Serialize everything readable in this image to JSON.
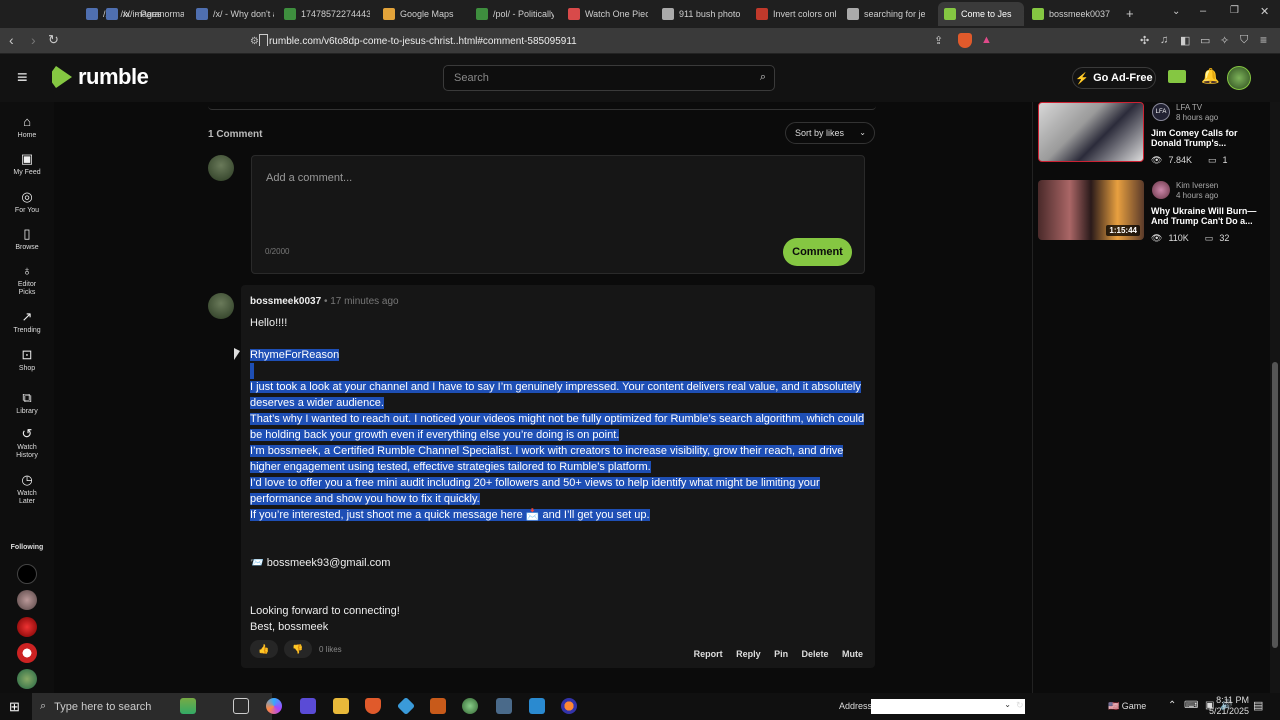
{
  "tabs": [
    {
      "label": "/x/ - /x/ images",
      "color": "#4f6fb0"
    },
    {
      "label": "/x/ - Paranormal",
      "color": "#4f6fb0"
    },
    {
      "label": "/x/ - Why don't a",
      "color": "#4f6fb0"
    },
    {
      "label": "17478572274443",
      "color": "#3e8e3e"
    },
    {
      "label": "Google Maps",
      "color": "#e2a33a"
    },
    {
      "label": "/pol/ - Politically",
      "color": "#3e8e3e"
    },
    {
      "label": "Watch One Piece",
      "color": "#d84a4a"
    },
    {
      "label": "911 bush photo",
      "color": "#aaaaaa"
    },
    {
      "label": "Invert colors onli",
      "color": "#c0392b"
    },
    {
      "label": "searching for jes",
      "color": "#aaaaaa"
    },
    {
      "label": "Come to Jes",
      "color": "#85c742",
      "active": true
    },
    {
      "label": "bossmeek0037",
      "color": "#85c742"
    }
  ],
  "urlbar": {
    "url": "rumble.com/v6to8dp-come-to-jesus-christ..html#comment-585095911"
  },
  "header": {
    "logo_text": "rumble",
    "search_placeholder": "Search",
    "go_ad_free_label": "Go Ad-Free"
  },
  "sidebar": {
    "items": [
      {
        "label": "Home",
        "icon": "home-icon",
        "glyph": "⌂"
      },
      {
        "label": "My Feed",
        "icon": "feed-icon",
        "glyph": "▣"
      },
      {
        "label": "For You",
        "icon": "target-icon",
        "glyph": "◎"
      },
      {
        "label": "Browse",
        "icon": "browse-icon",
        "glyph": "▯"
      },
      {
        "label": "Editor Picks",
        "icon": "award-icon",
        "glyph": "♁"
      },
      {
        "label": "Trending",
        "icon": "trending-icon",
        "glyph": "↗"
      },
      {
        "label": "Shop",
        "icon": "shop-icon",
        "glyph": "⊡"
      },
      {
        "label": "Library",
        "icon": "library-icon",
        "glyph": "⧉"
      },
      {
        "label": "Watch History",
        "icon": "history-icon",
        "glyph": "↺"
      },
      {
        "label": "Watch Later",
        "icon": "clock-icon",
        "glyph": "◷"
      }
    ],
    "following_label": "Following"
  },
  "comments": {
    "count_label": "1 Comment",
    "sort_label": "Sort by likes",
    "add_placeholder": "Add a comment...",
    "char_count": "0/2000",
    "submit_label": "Comment",
    "item": {
      "username": "bossmeek0037",
      "time": "17 minutes ago",
      "greeting": "Hello!!!!",
      "highlighted_lines": [
        "RhymeForReason",
        "I just took a look at your channel and I have to say I’m genuinely impressed. Your content delivers real value, and it absolutely deserves a wider audience.",
        "That’s why I wanted to reach out. I noticed your videos might not be fully optimized for Rumble’s search algorithm, which could be holding back your growth even if everything else you’re doing is on point.",
        "I’m bossmeek, a Certified Rumble Channel Specialist. I work with creators to increase visibility, grow their reach, and drive higher engagement using tested, effective strategies tailored to Rumble’s platform.",
        "I’d love to offer you a free mini audit including 20+ followers and 50+ views to help identify what might be limiting your performance and show you how to fix it quickly.",
        "If you’re interested, just shoot me a quick message here 📩 and I’ll get you set up."
      ],
      "email": "📨 bossmeek93@gmail.com",
      "closing1": "Looking forward to connecting!",
      "closing2": "Best, bossmeek",
      "likes": "0 likes",
      "actions": [
        "Report",
        "Reply",
        "Pin",
        "Delete",
        "Mute"
      ]
    }
  },
  "related": [
    {
      "channel": "LFA TV",
      "time": "8 hours ago",
      "title": "Jim Comey Calls for Donald Trump's...",
      "views": "7.84K",
      "comments": "1",
      "duration": ""
    },
    {
      "channel": "Kim Iversen",
      "time": "4 hours ago",
      "title": "Why Ukraine Will Burn—And Trump Can't Do a...",
      "views": "110K",
      "comments": "32",
      "duration": "1:15:44"
    }
  ],
  "taskbar": {
    "search_placeholder": "Type here to search",
    "address_label": "Address",
    "game_label": "Game",
    "time": "8:11 PM",
    "date": "5/21/2025"
  }
}
